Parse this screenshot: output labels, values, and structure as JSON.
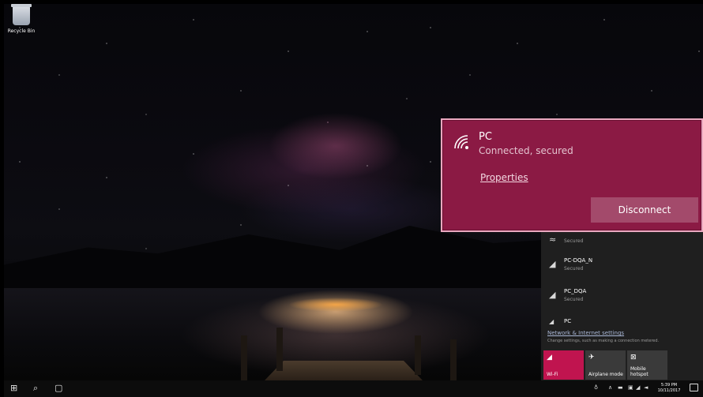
{
  "desktop": {
    "recycle_bin_label": "Recycle Bin"
  },
  "connected_network": {
    "name": "PC",
    "status": "Connected, secured",
    "properties_link": "Properties",
    "disconnect_label": "Disconnect"
  },
  "networks": [
    {
      "name": "",
      "status": "Secured"
    },
    {
      "name": "PC-DQA_N",
      "status": "Secured"
    },
    {
      "name": "PC_DQA",
      "status": "Secured"
    },
    {
      "name": "PC",
      "status": ""
    }
  ],
  "settings": {
    "link": "Network & Internet settings",
    "description": "Change settings, such as making a connection metered."
  },
  "quick_actions": [
    {
      "label": "Wi-Fi",
      "icon": "wifi-icon",
      "active": true
    },
    {
      "label": "Airplane mode",
      "icon": "airplane-icon",
      "active": false
    },
    {
      "label": "Mobile hotspot",
      "icon": "hotspot-icon",
      "active": false
    }
  ],
  "clock": {
    "time": "5:39 PM",
    "date": "10/11/2017"
  },
  "colors": {
    "accent": "#8b1a44",
    "tile_active": "#c0144f"
  }
}
